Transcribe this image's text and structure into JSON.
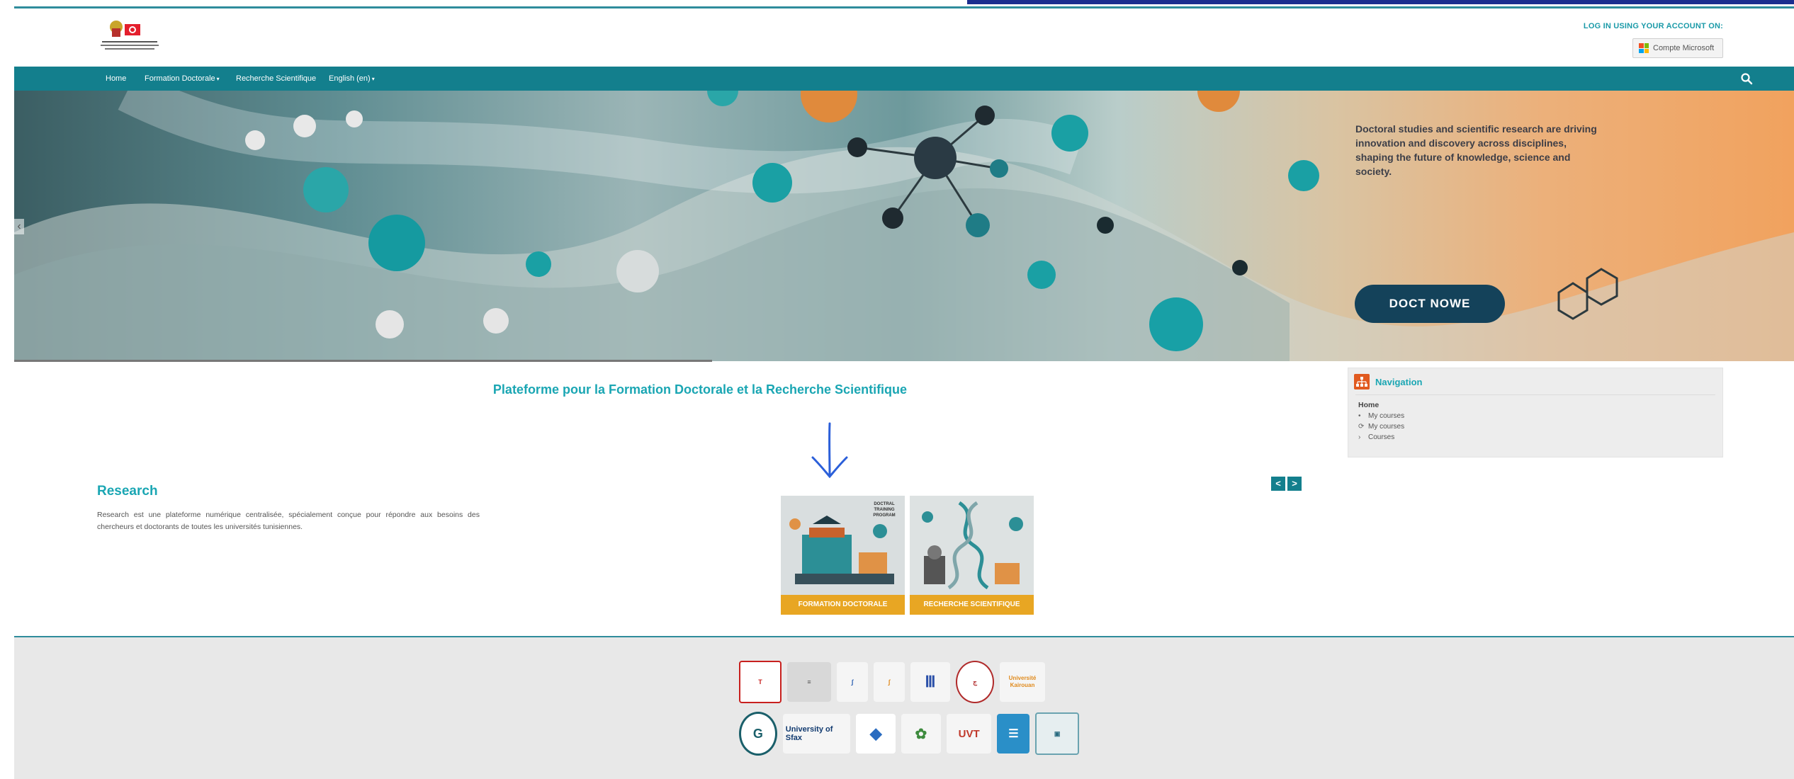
{
  "header": {
    "login_label": "LOG IN USING YOUR ACCOUNT ON:",
    "microsoft_button": "Compte Microsoft"
  },
  "navbar": {
    "items": [
      {
        "label": "Home"
      },
      {
        "label": "Formation Doctorale"
      },
      {
        "label": "Recherche Scientifique"
      },
      {
        "label": "English (en)"
      }
    ]
  },
  "hero": {
    "text": "Doctoral studies and scientific research are driving innovation and discovery across disciplines, shaping the future of knowledge, science and society.",
    "cta": "DOCT NOWE",
    "prev_label": "‹"
  },
  "main": {
    "platform_title": "Plateforme pour la Formation Doctorale et la Recherche Scientifique",
    "research_title": "Research",
    "research_description": "Research est une plateforme numérique centralisée, spécialement conçue pour répondre aux besoins des chercheurs et doctorants de toutes les universités tunisiennes.",
    "carousel_prev": "<",
    "carousel_next": ">",
    "cards": [
      {
        "label": "FORMATION DOCTORALE",
        "image_caption": "DOCTRAL TRAINING PROGRAM"
      },
      {
        "label": "RECHERCHE SCIENTIFIQUE"
      }
    ]
  },
  "navigation_block": {
    "title": "Navigation",
    "home": "Home",
    "items": [
      "My courses",
      "My courses",
      "Courses"
    ]
  },
  "footer": {
    "university_logos": [
      "Université de Tunis El Manar",
      "Université de la Manouba",
      "Université de Gabès",
      "Université de Sousse",
      "Université de Carthage",
      "Université de Jendouba",
      "Université de Kairouan",
      "Université de Gafsa",
      "Université de Sfax",
      "Université de Monastir",
      "Université Ez-Zitouna",
      "UVT",
      "Université de Tunis",
      "Université de Tunis (bâtiment)"
    ],
    "sfax_text": "University of Sfax",
    "uvt_text": "UVT",
    "kairouan_text": "Université Kairouan"
  },
  "colors": {
    "teal": "#137f8d",
    "title_teal": "#1aa6b3",
    "card_label": "#e8a623",
    "hero_cta": "#14425a"
  }
}
